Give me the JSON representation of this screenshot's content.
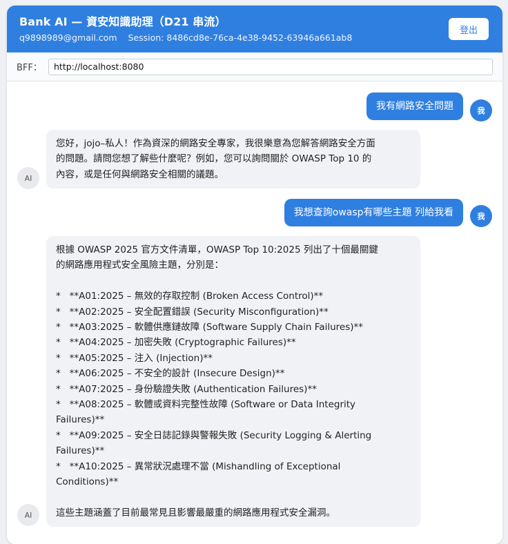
{
  "header": {
    "title": "Bank AI — 資安知識助理（D21 串流）",
    "email": "q9898989@gmail.com",
    "session": "Session: 8486cd8e-76ca-4e38-9452-63946a661ab8",
    "logout_label": "登出"
  },
  "bff": {
    "label": "BFF：",
    "value": "http://localhost:8080"
  },
  "messages": [
    {
      "role": "user",
      "avatar": "我",
      "text": "我有網路安全問題"
    },
    {
      "role": "ai",
      "avatar": "AI",
      "text": "您好，jojo–私人！作為資深的網路安全專家，我很樂意為您解答網路安全方面\n的問題。請問您想了解些什麼呢？例如，您可以詢問關於 OWASP Top 10 的\n內容，或是任何與網路安全相關的議題。"
    },
    {
      "role": "user",
      "avatar": "我",
      "text": "我想查詢owasp有哪些主題 列給我看"
    },
    {
      "role": "ai",
      "avatar": "AI",
      "text": "根據 OWASP 2025 官方文件清單，OWASP Top 10:2025 列出了十個最關鍵\n的網路應用程式安全風險主題，分別是：\n\n*   **A01:2025 – 無效的存取控制 (Broken Access Control)**\n*   **A02:2025 – 安全配置錯誤 (Security Misconfiguration)**\n*   **A03:2025 – 軟體供應鏈故障 (Software Supply Chain Failures)**\n*   **A04:2025 – 加密失敗 (Cryptographic Failures)**\n*   **A05:2025 – 注入 (Injection)**\n*   **A06:2025 – 不安全的設計 (Insecure Design)**\n*   **A07:2025 – 身份驗證失敗 (Authentication Failures)**\n*   **A08:2025 – 軟體或資料完整性故障 (Software or Data Integrity\nFailures)**\n*   **A09:2025 – 安全日誌記錄與警報失敗 (Security Logging & Alerting\nFailures)**\n*   **A10:2025 – 異常狀況處理不當 (Mishandling of Exceptional\nConditions)**\n\n這些主題涵蓋了目前最常見且影響最嚴重的網路應用程式安全漏洞。"
    }
  ],
  "colors": {
    "accent": "#2f7fe0",
    "ai_bubble": "#f1f2f5",
    "page_bg": "#eef0f4"
  }
}
